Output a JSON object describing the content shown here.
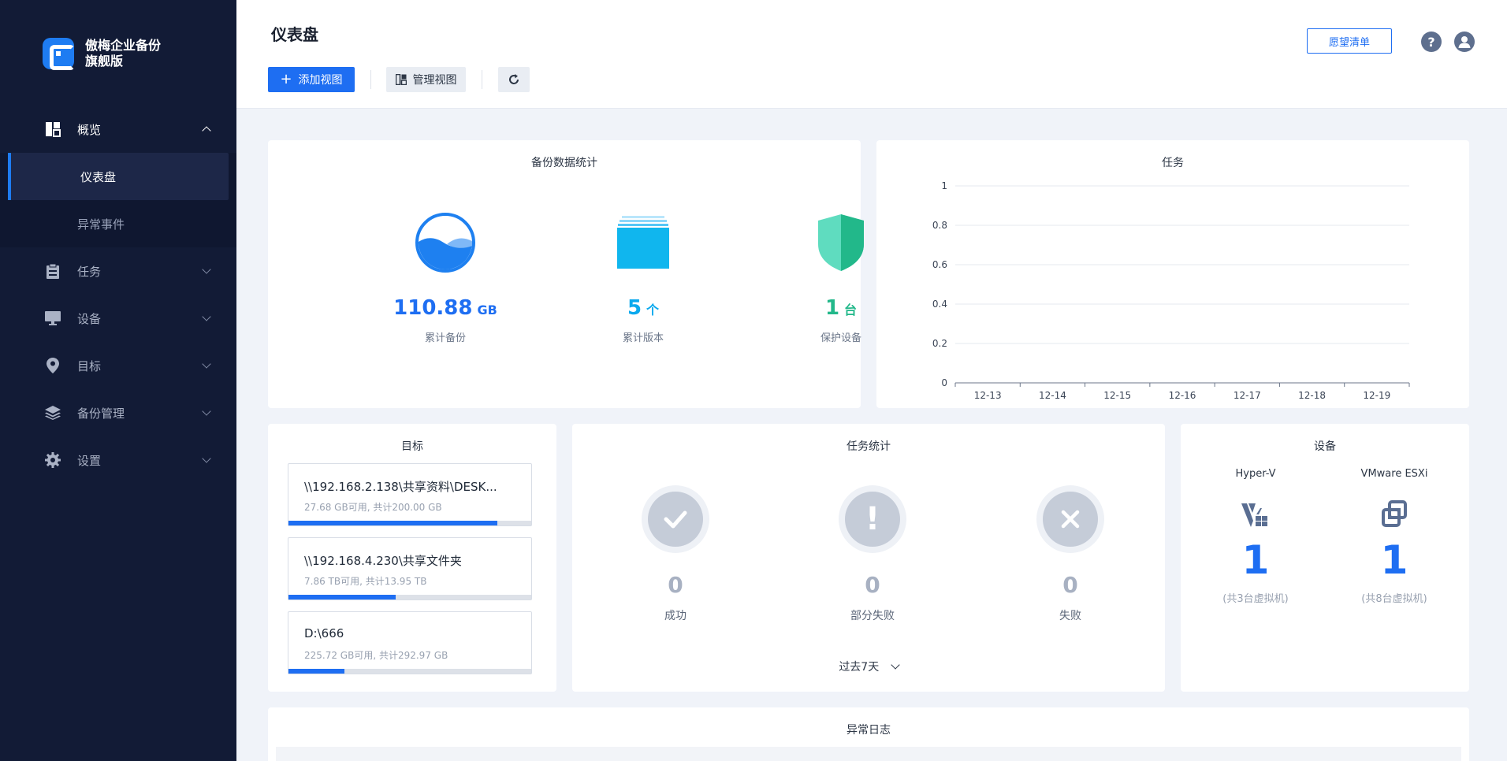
{
  "app": {
    "logo_line1": "傲梅企业备份",
    "logo_line2": "旗舰版"
  },
  "sidebar": {
    "items": [
      {
        "label": "概览",
        "icon": "dashboard-icon"
      },
      {
        "label": "任务",
        "icon": "clipboard-icon"
      },
      {
        "label": "设备",
        "icon": "monitor-icon"
      },
      {
        "label": "目标",
        "icon": "location-pin-icon"
      },
      {
        "label": "备份管理",
        "icon": "layers-icon"
      },
      {
        "label": "设置",
        "icon": "gear-icon"
      }
    ],
    "sub_items": [
      {
        "label": "仪表盘",
        "active": true
      },
      {
        "label": "异常事件",
        "active": false
      }
    ]
  },
  "header": {
    "title": "仪表盘",
    "add_view": "添加视图",
    "manage_view": "管理视图",
    "wishlist": "愿望清单"
  },
  "backup_stats": {
    "title": "备份数据统计",
    "items": [
      {
        "value": "110.88",
        "unit": "GB",
        "label": "累计备份",
        "color": "#1e6ef2"
      },
      {
        "value": "5",
        "unit": "个",
        "label": "累计版本",
        "color": "#0aa9ee"
      },
      {
        "value": "1",
        "unit": "台",
        "label": "保护设备",
        "color": "#22b88a"
      }
    ]
  },
  "tasks_chart": {
    "title": "任务",
    "chart_data": {
      "type": "line",
      "title": "任务",
      "categories": [
        "12-13",
        "12-14",
        "12-15",
        "12-16",
        "12-17",
        "12-18",
        "12-19"
      ],
      "yticks": [
        "0",
        "0.2",
        "0.4",
        "0.6",
        "0.8",
        "1"
      ],
      "ylim": [
        0,
        1
      ],
      "series": [],
      "grid": true
    }
  },
  "targets": {
    "title": "目标",
    "items": [
      {
        "name": "\\\\192.168.2.138\\共享资料\\DESK...",
        "capacity": "27.68 GB可用, 共计200.00 GB",
        "used_fraction": 0.86
      },
      {
        "name": "\\\\192.168.4.230\\共享文件夹",
        "capacity": "7.86 TB可用, 共计13.95 TB",
        "used_fraction": 0.44
      },
      {
        "name": "D:\\666",
        "capacity": "225.72 GB可用, 共计292.97 GB",
        "used_fraction": 0.23
      }
    ]
  },
  "task_stats": {
    "title": "任务统计",
    "items": [
      {
        "count": "0",
        "label": "成功",
        "icon": "check-icon"
      },
      {
        "count": "0",
        "label": "部分失败",
        "icon": "exclamation-icon"
      },
      {
        "count": "0",
        "label": "失败",
        "icon": "x-icon"
      }
    ],
    "period": "过去7天"
  },
  "devices": {
    "title": "设备",
    "items": [
      {
        "name": "Hyper-V",
        "count": "1",
        "sub": "(共3台虚拟机)",
        "icon": "hyper-v-icon"
      },
      {
        "name": "VMware ESXi",
        "count": "1",
        "sub": "(共8台虚拟机)",
        "icon": "vmware-icon"
      }
    ]
  },
  "exception_log": {
    "title": "异常日志"
  }
}
